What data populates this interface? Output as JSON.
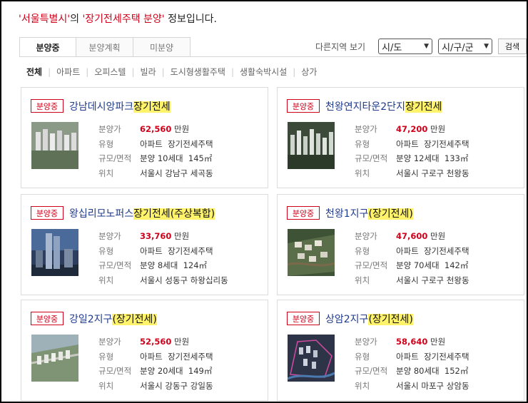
{
  "header": {
    "region_text": "'서울특별시'",
    "mid": "의 ",
    "type_text": "'장기전세주택 분양'",
    "tail": " 정보입니다."
  },
  "tabs": [
    {
      "label": "분양중",
      "active": true
    },
    {
      "label": "분양계획",
      "active": false
    },
    {
      "label": "미분양",
      "active": false
    }
  ],
  "region_filter": {
    "label": "다른지역 보기",
    "sido_value": "시/도",
    "sigungu_value": "시/구/군",
    "search_label": "검색"
  },
  "filters": [
    "전체",
    "아파트",
    "오피스텔",
    "빌라",
    "도시형생활주택",
    "생활숙박시설",
    "상가"
  ],
  "listings": [
    {
      "badge": "분양중",
      "name": "강남데시앙파크",
      "tag": "장기전세",
      "price_label": "분양가",
      "price": "62,560",
      "unit": "만원",
      "type_label": "유형",
      "type": "아파트",
      "subtype": "장기전세주택",
      "size_label": "규모/면적",
      "units": "분양 10세대",
      "area": "145㎡",
      "loc_label": "위치",
      "location": "서울시 강남구 세곡동"
    },
    {
      "badge": "분양중",
      "name": "천왕연지타운2단지",
      "tag": "장기전세",
      "price_label": "분양가",
      "price": "47,200",
      "unit": "만원",
      "type_label": "유형",
      "type": "아파트",
      "subtype": "장기전세주택",
      "size_label": "규모/면적",
      "units": "분양 12세대",
      "area": "133㎡",
      "loc_label": "위치",
      "location": "서울시 구로구 천왕동"
    },
    {
      "badge": "분양중",
      "name": "왕십리모노퍼스",
      "tag": "장기전세(주상복합)",
      "price_label": "분양가",
      "price": "33,760",
      "unit": "만원",
      "type_label": "유형",
      "type": "아파트",
      "subtype": "장기전세주택",
      "size_label": "규모/면적",
      "units": "분양 8세대",
      "area": "124㎡",
      "loc_label": "위치",
      "location": "서울시 성동구 하왕십리동"
    },
    {
      "badge": "분양중",
      "name": "천왕1지구",
      "tag": "(장기전세)",
      "price_label": "분양가",
      "price": "47,600",
      "unit": "만원",
      "type_label": "유형",
      "type": "아파트",
      "subtype": "장기전세주택",
      "size_label": "규모/면적",
      "units": "분양 70세대",
      "area": "142㎡",
      "loc_label": "위치",
      "location": "서울시 구로구 천왕동"
    },
    {
      "badge": "분양중",
      "name": "강일2지구",
      "tag": "(장기전세)",
      "price_label": "분양가",
      "price": "52,560",
      "unit": "만원",
      "type_label": "유형",
      "type": "아파트",
      "subtype": "장기전세주택",
      "size_label": "규모/면적",
      "units": "분양 20세대",
      "area": "149㎡",
      "loc_label": "위치",
      "location": "서울시 강동구 강일동"
    },
    {
      "badge": "분양중",
      "name": "상암2지구",
      "tag": "(장기전세)",
      "price_label": "분양가",
      "price": "58,640",
      "unit": "만원",
      "type_label": "유형",
      "type": "아파트",
      "subtype": "장기전세주택",
      "size_label": "규모/면적",
      "units": "분양 80세대",
      "area": "152㎡",
      "loc_label": "위치",
      "location": "서울시 마포구 상암동"
    }
  ],
  "colors": {
    "accent_red": "#d0021b",
    "title_blue": "#1f3b8c",
    "highlight": "#fff36b"
  }
}
